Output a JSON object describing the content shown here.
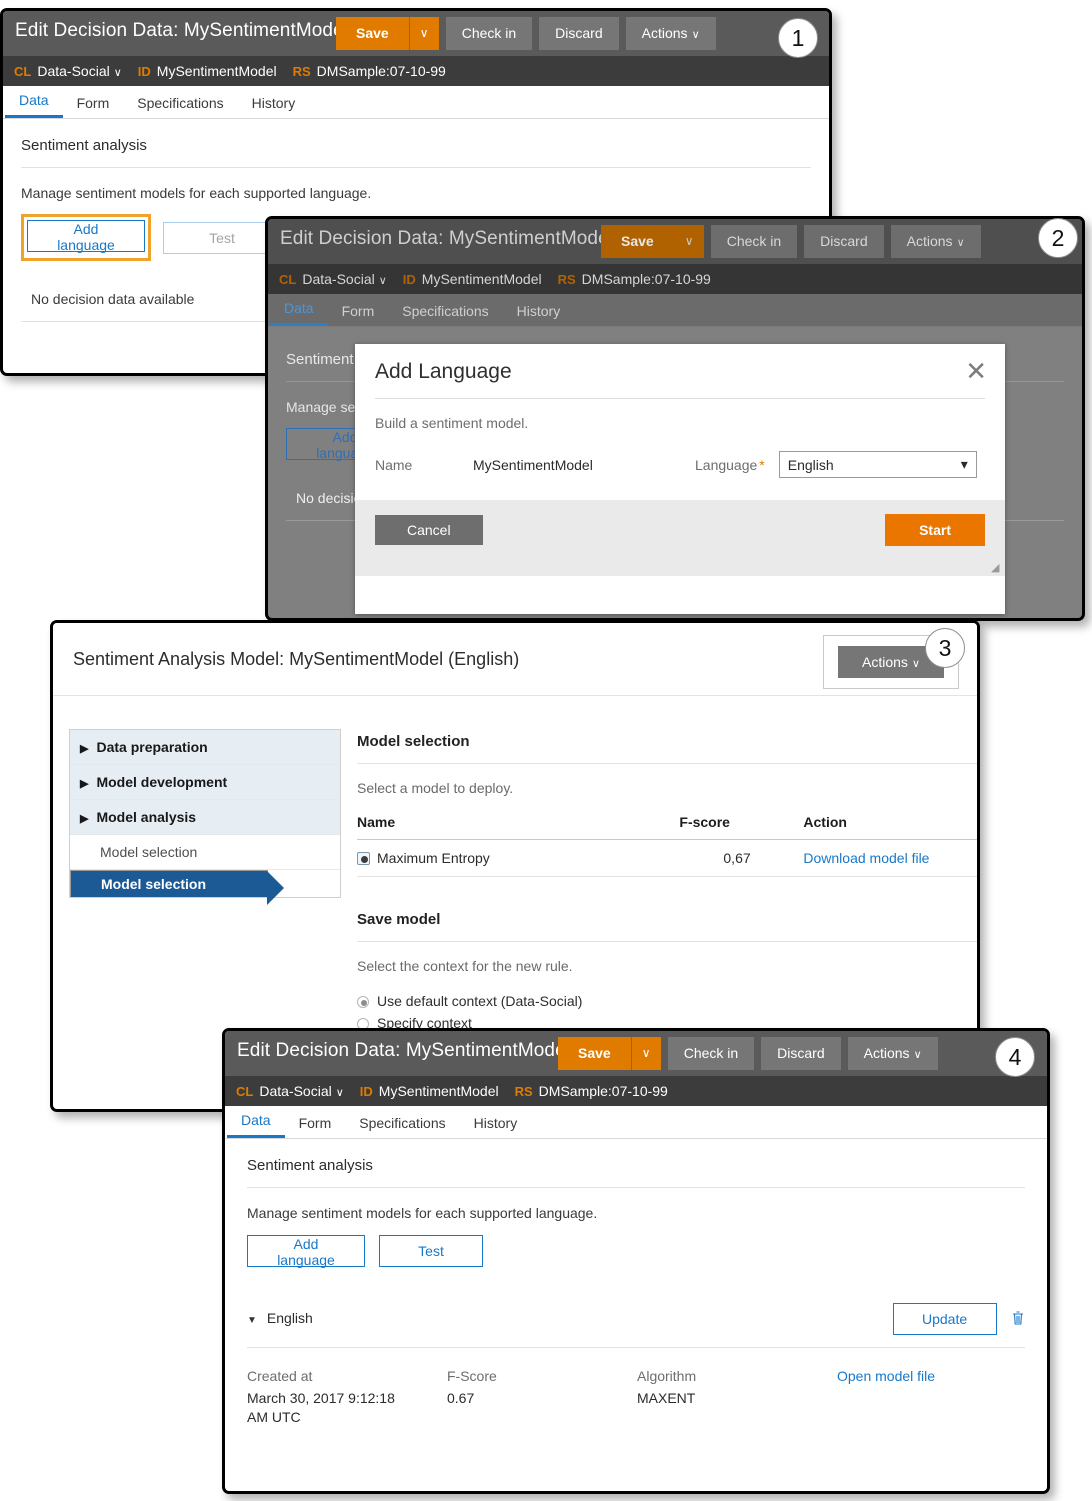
{
  "app": {
    "title": "Edit Decision Data: MySentimentModel",
    "save_label": "Save",
    "save_caret": "⌄",
    "checkin_label": "Check in",
    "discard_label": "Discard",
    "actions_label": "Actions",
    "actions_caret": "∨",
    "breadcrumb": {
      "cl_tag": "CL",
      "cl_value": "Data-Social",
      "cl_caret": "∨",
      "id_tag": "ID",
      "id_value": "MySentimentModel",
      "rs_tag": "RS",
      "rs_value": "DMSample:07-10-99"
    },
    "tabs": [
      {
        "label": "Data",
        "active": true
      },
      {
        "label": "Form",
        "active": false
      },
      {
        "label": "Specifications",
        "active": false
      },
      {
        "label": "History",
        "active": false
      }
    ]
  },
  "sentiment": {
    "section_title": "Sentiment analysis",
    "description": "Manage sentiment models for each supported language.",
    "add_language_label": "Add language",
    "test_label": "Test",
    "no_data_label": "No decision data available"
  },
  "badges": {
    "one": "1",
    "two": "2",
    "three": "3",
    "four": "4"
  },
  "modal": {
    "title": "Add Language",
    "close_icon": "✕",
    "subtitle": "Build a sentiment model.",
    "name_label": "Name",
    "name_value": "MySentimentModel",
    "language_label": "Language",
    "required_mark": "*",
    "language_value": "English",
    "language_caret": "▾",
    "cancel_label": "Cancel",
    "start_label": "Start",
    "resize_icon": "◢"
  },
  "model_window": {
    "title": "Sentiment Analysis Model: MySentimentModel  (English)",
    "actions_label": "Actions",
    "actions_caret": "∨",
    "nav": [
      {
        "label": "Data preparation",
        "type": "group",
        "icon": "▶"
      },
      {
        "label": "Model development",
        "type": "group",
        "icon": "▶"
      },
      {
        "label": "Model analysis",
        "type": "group",
        "icon": "▶"
      },
      {
        "label": "Model selection",
        "type": "leaf",
        "icon": ""
      },
      {
        "label": "Model selection",
        "type": "selected",
        "icon": ""
      }
    ],
    "model_selection": {
      "heading": "Model selection",
      "note": "Select a model to deploy.",
      "columns": [
        "Name",
        "F-score",
        "Action"
      ],
      "rows": [
        {
          "name": "Maximum Entropy",
          "fscore": "0,67",
          "action": "Download model file"
        }
      ]
    },
    "save_model": {
      "heading": "Save model",
      "note": "Select the context for the new rule.",
      "options": [
        {
          "label": "Use default context (Data-Social)",
          "selected": true
        },
        {
          "label": "Specify context",
          "selected": false
        }
      ]
    }
  },
  "result": {
    "language_label": "English",
    "expand_icon": "▼",
    "update_label": "Update",
    "delete_icon": "Ὕ1",
    "fields": [
      {
        "label": "Created at",
        "value": "March 30, 2017 9:12:18 AM UTC"
      },
      {
        "label": "F-Score",
        "value": "0.67"
      },
      {
        "label": "Algorithm",
        "value": "MAXENT"
      }
    ],
    "open_model_file": "Open model file"
  },
  "colors": {
    "accent_orange": "#e07b00",
    "link_blue": "#1878c8",
    "selected_nav_blue": "#1c5a96",
    "highlight_orange": "#f0a22a"
  }
}
